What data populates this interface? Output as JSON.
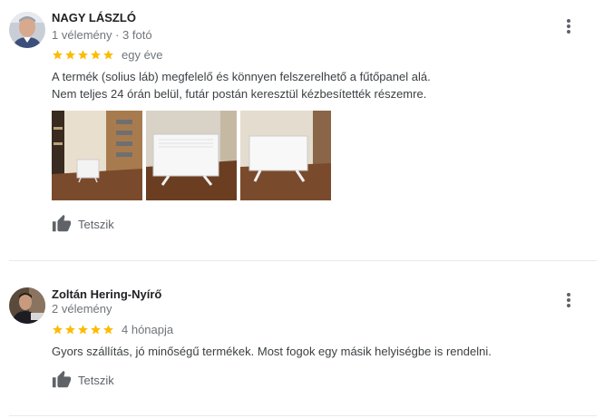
{
  "reviews": [
    {
      "author": "NAGY LÁSZLÓ",
      "meta": "1 vélemény · 3 fotó",
      "rating": 5,
      "time": "egy éve",
      "text_lines": [
        "A termék (solius láb) megfelelő és könnyen felszerelhető a fűtőpanel alá.",
        "Nem teljes 24 órán belül, futár postán keresztül kézbesítették részemre."
      ],
      "like_label": "Tetszik",
      "photo_count": 3
    },
    {
      "author": "Zoltán Hering-Nyírő",
      "meta": "2 vélemény",
      "rating": 5,
      "time": "4 hónapja",
      "text_lines": [
        "Gyors szállítás, jó minőségű termékek. Most fogok egy másik helyiségbe is rendelni."
      ],
      "like_label": "Tetszik"
    }
  ],
  "colors": {
    "star": "#fbbc04",
    "text": "#3c4043",
    "secondary": "#70757a",
    "divider": "#e8eaed"
  },
  "icons": [
    "avatar",
    "star-icon",
    "more-vert-icon",
    "thumbs-up-icon"
  ]
}
